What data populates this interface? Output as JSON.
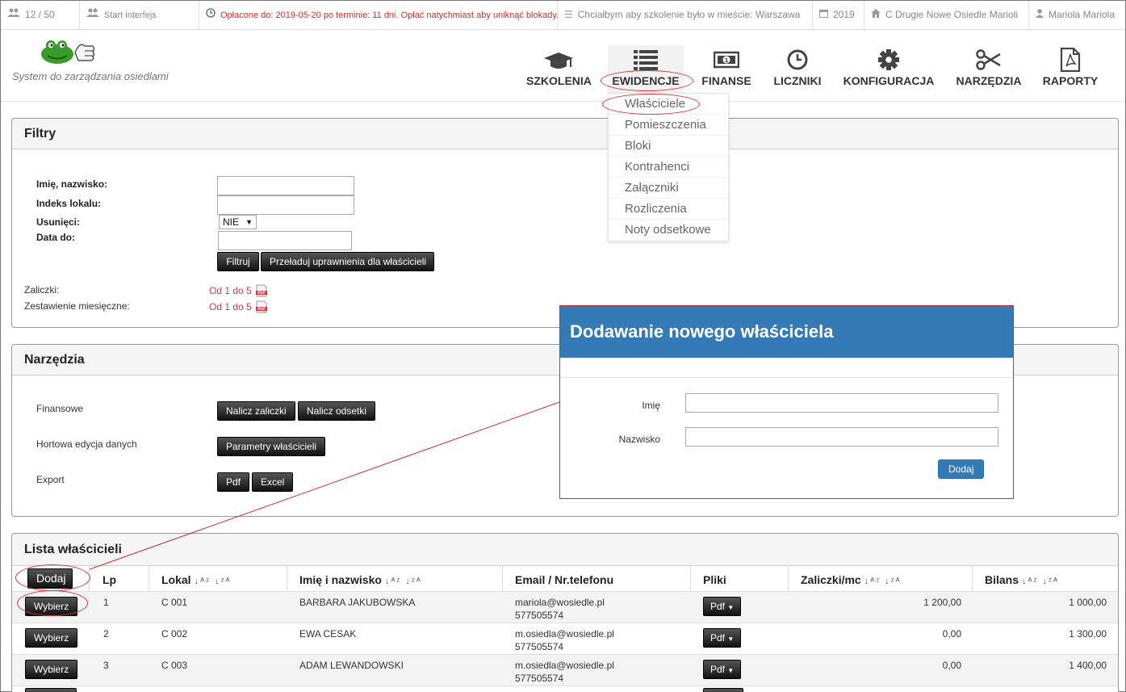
{
  "topbar": {
    "counter": "12 / 50",
    "start": "Start interfejs",
    "payment_notice": "Opłacone do: 2019-05-20 po terminie: 11 dni. Opłać natychmiast aby uniknąć blokady.",
    "training_city": "Chciałbym aby szkolenie było w mieście: Warszawa",
    "year": "2019",
    "estate": "C Drugie Nowe Osiedle Marioli",
    "user": "Mariola Mariola"
  },
  "brand": {
    "tagline": "System do zarządzania osiedlami"
  },
  "nav": [
    {
      "label": "SZKOLENIA",
      "icon": "graduation-cap-icon"
    },
    {
      "label": "EWIDENCJE",
      "icon": "list-icon"
    },
    {
      "label": "FINANSE",
      "icon": "money-icon"
    },
    {
      "label": "LICZNIKI",
      "icon": "clock-icon"
    },
    {
      "label": "KONFIGURACJA",
      "icon": "gear-icon"
    },
    {
      "label": "NARZĘDZIA",
      "icon": "scissors-icon"
    },
    {
      "label": "RAPORTY",
      "icon": "pdf-file-icon"
    }
  ],
  "dropdown": [
    "Właściciele",
    "Pomieszczenia",
    "Bloki",
    "Kontrahenci",
    "Załączniki",
    "Rozliczenia",
    "Noty odsetkowe"
  ],
  "filters": {
    "title": "Filtry",
    "name_label": "Imię, nazwisko:",
    "index_label": "Indeks lokalu:",
    "deleted_label": "Usunięci:",
    "deleted_value": "NIE",
    "date_label": "Data do:",
    "filter_button": "Filtruj",
    "reload_button": "Przeładuj uprawnienia dla właścicieli",
    "advances_label": "Zaliczki:",
    "advances_link": "Od 1 do 5",
    "monthly_label": "Zestawienie miesięczne:",
    "monthly_link": "Od 1 do 5"
  },
  "tools": {
    "title": "Narzędzia",
    "finance_label": "Finansowe",
    "advances_button": "Nalicz zaliczki",
    "interest_button": "Nalicz odsetki",
    "bulk_label": "Hortowa edycja danych",
    "params_button": "Parametry właścicieli",
    "export_label": "Export",
    "pdf_button": "Pdf",
    "excel_button": "Excel"
  },
  "modal": {
    "title": "Dodawanie nowego właściciela",
    "first_name_label": "Imię",
    "last_name_label": "Nazwisko",
    "add_button": "Dodaj"
  },
  "owners": {
    "title": "Lista właścicieli",
    "add_button": "Dodaj",
    "columns": [
      "Lp",
      "Lokal",
      "Imię i nazwisko",
      "Email / Nr.telefonu",
      "Pliki",
      "Zaliczki/mc",
      "Bilans"
    ],
    "select_label": "Wybierz",
    "files_label": "Pdf",
    "rows": [
      {
        "lp": "1",
        "unit": "C 001",
        "name": "BARBARA JAKUBOWSKA",
        "email": "mariola@wosiedle.pl",
        "phone": "577505574",
        "advance": "1 200,00",
        "balance": "1 000,00"
      },
      {
        "lp": "2",
        "unit": "C 002",
        "name": "EWA CESAK",
        "email": "m.osiedla@wosiedle.pl",
        "phone": "577505574",
        "advance": "0,00",
        "balance": "1 300,00"
      },
      {
        "lp": "3",
        "unit": "C 003",
        "name": "ADAM LEWANDOWSKI",
        "email": "m.osiedla@wosiedle.pl",
        "phone": "577505574",
        "advance": "0,00",
        "balance": "1 400,00"
      }
    ]
  },
  "colors": {
    "accent": "#337ab7",
    "alert": "#c9302c"
  }
}
